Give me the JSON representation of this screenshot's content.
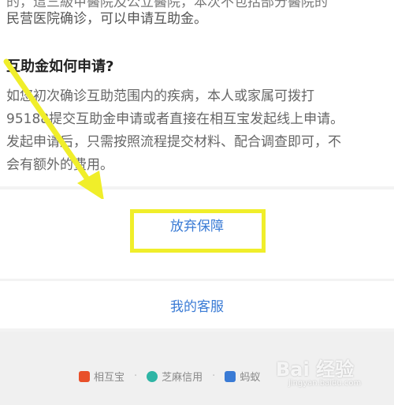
{
  "content": {
    "partial_top_line": "的，這三級甲醫院及公立醫院，本次不包括部分醫院的",
    "line1": "民营医院确诊，可以申请互助金。",
    "heading": "互助金如何申请?",
    "paragraph_lines": [
      "如您初次确诊互助范围内的疾病，本人或家属可拨打",
      "95188提交互助金申请或者直接在相互宝发起线上申请。",
      "发起申请后，只需按照流程提交材料、配合调查即可，不",
      "会有额外的费用。"
    ]
  },
  "actions": {
    "give_up_label": "放弃保障",
    "customer_service_label": "我的客服"
  },
  "footer": {
    "brands": [
      {
        "label": "相互宝",
        "icon": "xianghubao-icon",
        "color": "#e8502a"
      },
      {
        "label": "芝麻信用",
        "icon": "sesame-credit-icon",
        "color": "#2fb5a5"
      },
      {
        "label": "蚂蚁",
        "icon": "ant-icon",
        "color": "#3a7bd5"
      }
    ]
  },
  "watermark": {
    "brand": "Bai 经验",
    "url": "jingyan.baidu.com"
  },
  "colors": {
    "accent": "#3a7bd5",
    "highlight": "#f0ee2a"
  }
}
